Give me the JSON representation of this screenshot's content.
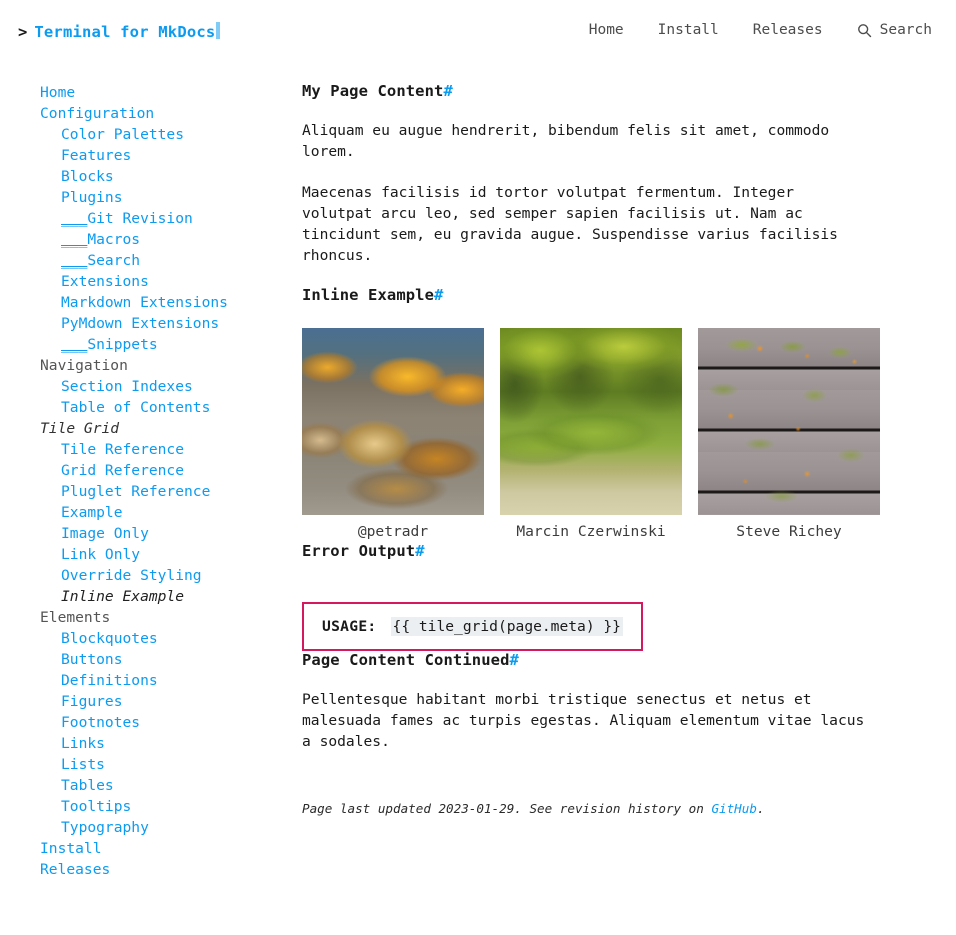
{
  "header": {
    "prompt": ">",
    "site_title": "Terminal for MkDocs",
    "nav": [
      {
        "label": "Home"
      },
      {
        "label": "Install"
      },
      {
        "label": "Releases"
      }
    ],
    "search": {
      "icon": "search-icon",
      "label": "Search"
    }
  },
  "sidebar": {
    "items": [
      {
        "label": "Home",
        "level": 1,
        "kind": "link"
      },
      {
        "label": "Configuration",
        "level": 1,
        "kind": "link"
      },
      {
        "label": "Color Palettes",
        "level": 2,
        "kind": "link"
      },
      {
        "label": "Features",
        "level": 2,
        "kind": "link"
      },
      {
        "label": "Blocks",
        "level": 2,
        "kind": "link"
      },
      {
        "label": "Plugins",
        "level": 2,
        "kind": "link"
      },
      {
        "label": "Git Revision",
        "level": 2,
        "kind": "link",
        "prefix": "___"
      },
      {
        "label": "Macros",
        "level": 2,
        "kind": "link",
        "prefix": "___"
      },
      {
        "label": "Search",
        "level": 2,
        "kind": "link",
        "prefix": "___"
      },
      {
        "label": "Extensions",
        "level": 2,
        "kind": "link"
      },
      {
        "label": "Markdown Extensions",
        "level": 2,
        "kind": "link"
      },
      {
        "label": "PyMdown Extensions",
        "level": 2,
        "kind": "link"
      },
      {
        "label": "Snippets",
        "level": 2,
        "kind": "link",
        "prefix": "___"
      },
      {
        "label": "Navigation",
        "level": 1,
        "kind": "section"
      },
      {
        "label": "Section Indexes",
        "level": 2,
        "kind": "link"
      },
      {
        "label": "Table of Contents",
        "level": 2,
        "kind": "link"
      },
      {
        "label": "Tile Grid",
        "level": 1,
        "kind": "active-section"
      },
      {
        "label": "Tile Reference",
        "level": 2,
        "kind": "link"
      },
      {
        "label": "Grid Reference",
        "level": 2,
        "kind": "link"
      },
      {
        "label": "Pluglet Reference",
        "level": 2,
        "kind": "link"
      },
      {
        "label": "Example",
        "level": 2,
        "kind": "link"
      },
      {
        "label": "Image Only",
        "level": 2,
        "kind": "link"
      },
      {
        "label": "Link Only",
        "level": 2,
        "kind": "link"
      },
      {
        "label": "Override Styling",
        "level": 2,
        "kind": "link"
      },
      {
        "label": "Inline Example",
        "level": 2,
        "kind": "current"
      },
      {
        "label": "Elements",
        "level": 1,
        "kind": "section"
      },
      {
        "label": "Blockquotes",
        "level": 2,
        "kind": "link"
      },
      {
        "label": "Buttons",
        "level": 2,
        "kind": "link"
      },
      {
        "label": "Definitions",
        "level": 2,
        "kind": "link"
      },
      {
        "label": "Figures",
        "level": 2,
        "kind": "link"
      },
      {
        "label": "Footnotes",
        "level": 2,
        "kind": "link"
      },
      {
        "label": "Links",
        "level": 2,
        "kind": "link"
      },
      {
        "label": "Lists",
        "level": 2,
        "kind": "link"
      },
      {
        "label": "Tables",
        "level": 2,
        "kind": "link"
      },
      {
        "label": "Tooltips",
        "level": 2,
        "kind": "link"
      },
      {
        "label": "Typography",
        "level": 2,
        "kind": "link"
      },
      {
        "label": "Install",
        "level": 1,
        "kind": "link"
      },
      {
        "label": "Releases",
        "level": 1,
        "kind": "link"
      }
    ]
  },
  "content": {
    "heading_1": "My Page Content",
    "anchor_symbol": "#",
    "paragraph_1": "Aliquam eu augue hendrerit, bibendum felis sit amet, commodo lorem.",
    "paragraph_2": "Maecenas facilisis id tortor volutpat fermentum. Integer volutpat arcu leo, sed semper sapien facilisis ut. Nam ac tincidunt sem, eu gravida augue. Suspendisse varius facilisis rhoncus.",
    "heading_2": "Inline Example",
    "tiles": [
      {
        "caption": "@petradr",
        "image": "autumn-leaves-photo"
      },
      {
        "caption": "Marcin Czerwinski",
        "image": "green-moss-forest-photo"
      },
      {
        "caption": "Steve Richey",
        "image": "weathered-planks-photo"
      }
    ],
    "heading_3": "Error Output",
    "error": {
      "label": "USAGE:",
      "code": "{{ tile_grid(page.meta) }}",
      "border_color": "#d4195e"
    },
    "heading_4": "Page Content Continued",
    "paragraph_3": "Pellentesque habitant morbi tristique senectus et netus et malesuada fames ac turpis egestas. Aliquam elementum vitae lacus a sodales.",
    "meta": {
      "text_before": "Page last updated 2023-01-29. See revision history on ",
      "link_label": "GitHub",
      "text_after": "."
    }
  },
  "colors": {
    "link": "#0d9bef",
    "text": "#1a1a1a",
    "muted": "#555555",
    "error_border": "#d4195e",
    "code_bg": "#eceff1"
  }
}
